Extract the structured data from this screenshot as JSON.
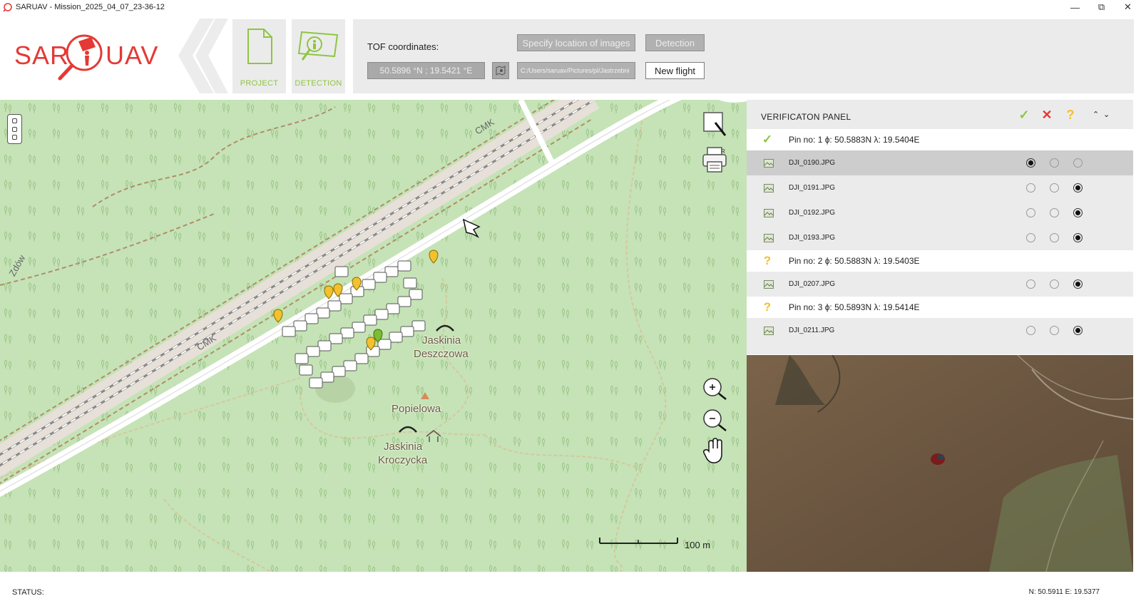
{
  "window": {
    "title": "SARUAV - Mission_2025_04_07_23-36-12",
    "minimize_icon": "minimize-icon",
    "maximize_icon": "restore-icon",
    "close_icon": "close-icon"
  },
  "toolbar": {
    "logo_text_left": "SAR",
    "logo_text_right": "UAV",
    "project_label": "PROJECT",
    "detection_label": "DETECTION",
    "tof_label": "TOF coordinates:",
    "tof_value": "50.5896 °N ;  19.5421 °E",
    "specify_location_label": "Specify location of images",
    "detection_button_label": "Detection",
    "images_path": "C:/Users/saruav/Pictures/pl/Jastrzebni",
    "new_flight_label": "New flight",
    "accent_color": "#8dc63f"
  },
  "map": {
    "labels": {
      "cave1_line1": "Jaskinia",
      "cave1_line2": "Deszczowa",
      "peak": "Popielowa",
      "cave2_line1": "Jaskinia",
      "cave2_line2": "Kroczycka",
      "road1": "CMK",
      "road2": "CMK",
      "road3": "Zdów"
    },
    "scale_label": "100 m",
    "tools": [
      "select-box-icon",
      "print-icon",
      "zoom-in-icon",
      "zoom-out-icon",
      "pan-hand-icon"
    ]
  },
  "verification": {
    "title": "VERIFICATON PANEL",
    "header_icons": [
      "accept-check-icon",
      "reject-x-icon",
      "unsure-question-icon",
      "collapse-up-icon",
      "expand-down-icon"
    ],
    "colors": {
      "accept": "#8dc63f",
      "reject": "#e53935",
      "unsure": "#f2c12e"
    },
    "pins": [
      {
        "status": "✓",
        "text": "Pin no:  1 ϕ: 50.5883N λ: 19.5404E",
        "images": [
          {
            "file": "DJI_0190.JPG",
            "choice": 0
          },
          {
            "file": "DJI_0191.JPG",
            "choice": 2
          },
          {
            "file": "DJI_0192.JPG",
            "choice": 2
          },
          {
            "file": "DJI_0193.JPG",
            "choice": 2
          }
        ]
      },
      {
        "status": "?",
        "text": "Pin no:  2 ϕ: 50.5883N λ: 19.5403E",
        "images": [
          {
            "file": "DJI_0207.JPG",
            "choice": 2
          }
        ]
      },
      {
        "status": "?",
        "text": "Pin no:  3 ϕ: 50.5893N λ: 19.5414E",
        "images": [
          {
            "file": "DJI_0211.JPG",
            "choice": 2
          }
        ]
      }
    ]
  },
  "status": {
    "label": "STATUS:",
    "coords": "N: 50.5911 E: 19.5377"
  }
}
